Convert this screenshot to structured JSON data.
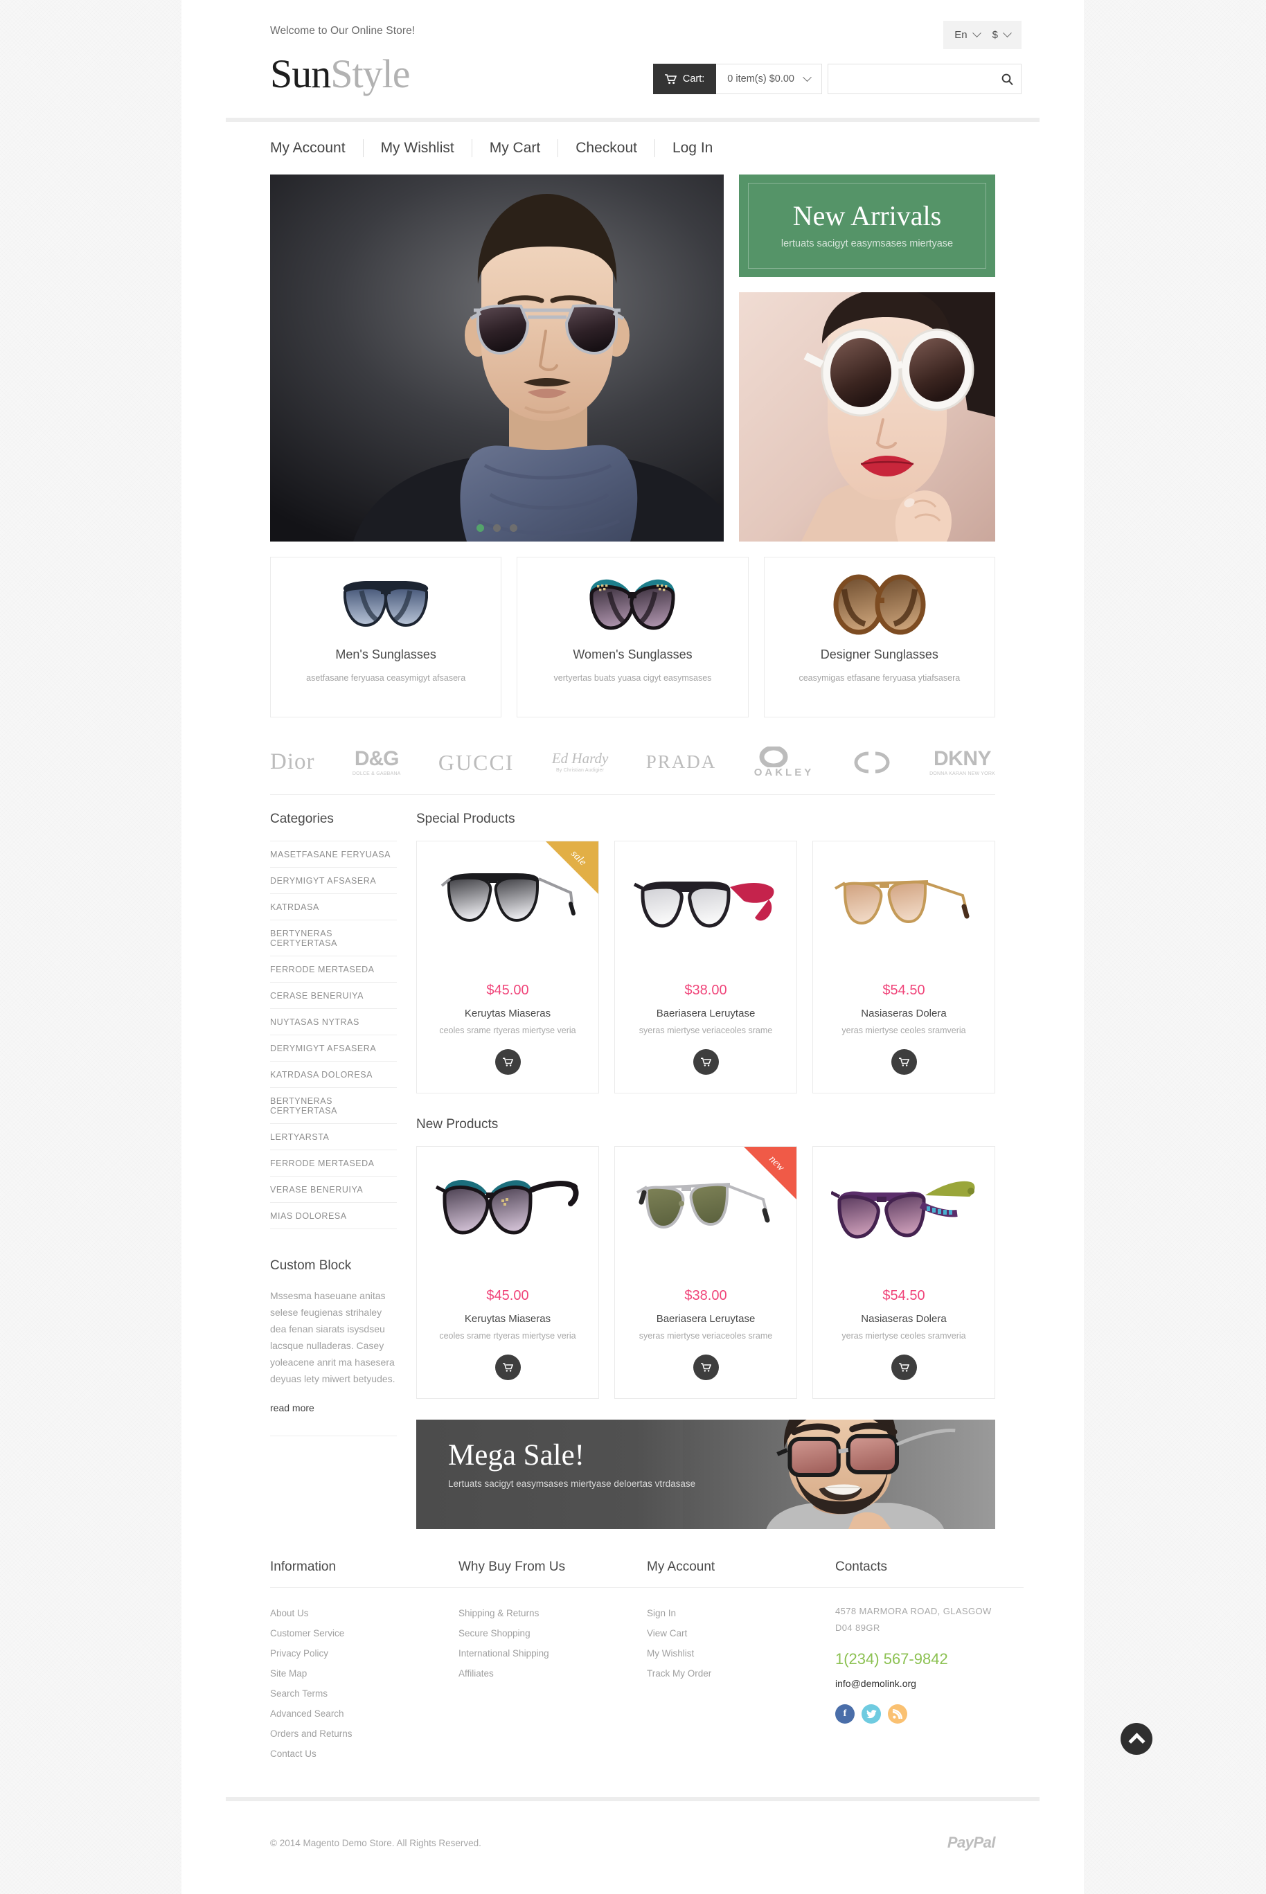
{
  "topbar": {
    "welcome": "Welcome to Our Online Store!",
    "language": "En",
    "currency": "$"
  },
  "header": {
    "logo_part1": "Sun",
    "logo_part2": "Style",
    "cart_label": "Cart:",
    "cart_summary": "0 item(s) $0.00",
    "search_placeholder": ""
  },
  "nav": {
    "items": [
      {
        "label": "My Account"
      },
      {
        "label": "My Wishlist"
      },
      {
        "label": "My Cart"
      },
      {
        "label": "Checkout"
      },
      {
        "label": "Log In"
      }
    ]
  },
  "hero": {
    "slider_dots": 3,
    "active_dot": 0,
    "new_arrivals": {
      "title": "New Arrivals",
      "subtitle": "lertuats sacigyt easymsases miertyase"
    }
  },
  "category_cards": [
    {
      "title": "Men's Sunglasses",
      "desc": "asetfasane feryuasa ceasymigyt afsasera"
    },
    {
      "title": "Women's Sunglasses",
      "desc": "vertyertas buats yuasa cigyt easymsases"
    },
    {
      "title": "Designer Sunglasses",
      "desc": "ceasymigas etfasane feryuasa ytiafsasera"
    }
  ],
  "brands": [
    {
      "name": "Dior",
      "sub": ""
    },
    {
      "name": "D&G",
      "sub": "DOLCE & GABBANA"
    },
    {
      "name": "GUCCI",
      "sub": ""
    },
    {
      "name": "Ed Hardy",
      "sub": "By Christian Audigier"
    },
    {
      "name": "PRADA",
      "sub": ""
    },
    {
      "name": "OAKLEY",
      "sub": ""
    },
    {
      "name": "CHANEL",
      "sub": ""
    },
    {
      "name": "DKNY",
      "sub": "DONNA KARAN NEW YORK"
    }
  ],
  "sidebar": {
    "categories_title": "Categories",
    "categories": [
      {
        "label": "MASETFASANE FERYUASA"
      },
      {
        "label": "DERYMIGYT AFSASERA"
      },
      {
        "label": "KATRDASA"
      },
      {
        "label": "BERTYNERAS CERTYERTASA"
      },
      {
        "label": "FERRODE MERTASEDA"
      },
      {
        "label": "CERASE BENERUIYA"
      },
      {
        "label": "NUYTASAS NYTRAS"
      },
      {
        "label": "DERYMIGYT AFSASERA"
      },
      {
        "label": "KATRDASA DOLORESA"
      },
      {
        "label": "BERTYNERAS CERTYERTASA"
      },
      {
        "label": "LERTYARSTA"
      },
      {
        "label": "FERRODE MERTASEDA"
      },
      {
        "label": "VERASE BENERUIYA"
      },
      {
        "label": "MIAS DOLORESA"
      }
    ],
    "custom_block_title": "Custom Block",
    "custom_block_text": "Mssesma haseuane anitas selese feugienas strihaley dea fenan siarats isysdseu lacsque nulladeras. Casey yoleacene anrit ma hasesera deyuas lety miwert betyudes.",
    "read_more": "read more"
  },
  "special_products": {
    "title": "Special Products",
    "items": [
      {
        "price": "$45.00",
        "name": "Keruytas Miaseras",
        "desc": "ceoles srame rtyeras miertyse veria",
        "badge": "sale",
        "badge_type": "sale"
      },
      {
        "price": "$38.00",
        "name": "Baeriasera Leruytase",
        "desc": "syeras miertyse veriaceoles srame",
        "badge": "",
        "badge_type": ""
      },
      {
        "price": "$54.50",
        "name": "Nasiaseras Dolera",
        "desc": "yeras miertyse ceoles sramveria",
        "badge": "",
        "badge_type": ""
      }
    ]
  },
  "new_products": {
    "title": "New Products",
    "items": [
      {
        "price": "$45.00",
        "name": "Keruytas Miaseras",
        "desc": "ceoles srame rtyeras miertyse veria",
        "badge": "",
        "badge_type": ""
      },
      {
        "price": "$38.00",
        "name": "Baeriasera Leruytase",
        "desc": "syeras miertyse veriaceoles srame",
        "badge": "new",
        "badge_type": "new"
      },
      {
        "price": "$54.50",
        "name": "Nasiaseras Dolera",
        "desc": "yeras miertyse ceoles sramveria",
        "badge": "",
        "badge_type": ""
      }
    ]
  },
  "mega_banner": {
    "title": "Mega Sale!",
    "subtitle": "Lertuats sacigyt easymsases miertyase deloertas vtrdasase"
  },
  "footer": {
    "information": {
      "title": "Information",
      "links": [
        {
          "label": "About Us"
        },
        {
          "label": "Customer Service"
        },
        {
          "label": "Privacy Policy"
        },
        {
          "label": "Site Map"
        },
        {
          "label": "Search Terms"
        },
        {
          "label": "Advanced Search"
        },
        {
          "label": "Orders and Returns"
        },
        {
          "label": "Contact Us"
        }
      ]
    },
    "why_buy": {
      "title": "Why Buy From Us",
      "links": [
        {
          "label": "Shipping & Returns"
        },
        {
          "label": "Secure Shopping"
        },
        {
          "label": "International Shipping"
        },
        {
          "label": "Affiliates"
        }
      ]
    },
    "my_account": {
      "title": "My Account",
      "links": [
        {
          "label": "Sign In"
        },
        {
          "label": "View Cart"
        },
        {
          "label": "My Wishlist"
        },
        {
          "label": "Track My Order"
        }
      ]
    },
    "contacts": {
      "title": "Contacts",
      "address_line1": "4578 MARMORA ROAD, GLASGOW",
      "address_line2": "D04 89GR",
      "phone": "1(234) 567-9842",
      "email": "info@demolink.org",
      "socials": [
        {
          "name": "facebook",
          "glyph": "f",
          "color": "#4a6ea9"
        },
        {
          "name": "twitter",
          "glyph": "",
          "color": "#6fcbe0"
        },
        {
          "name": "rss",
          "glyph": "",
          "color": "#fac172"
        }
      ]
    },
    "copyright": "© 2014 Magento Demo Store. All Rights Reserved.",
    "payment": "PayPal"
  },
  "colors": {
    "accent_green": "#559468",
    "price_pink": "#f0457a",
    "phone_green": "#8cc152",
    "sale_badge": "#e2af46",
    "new_badge": "#f05a47",
    "dark": "#343434"
  }
}
